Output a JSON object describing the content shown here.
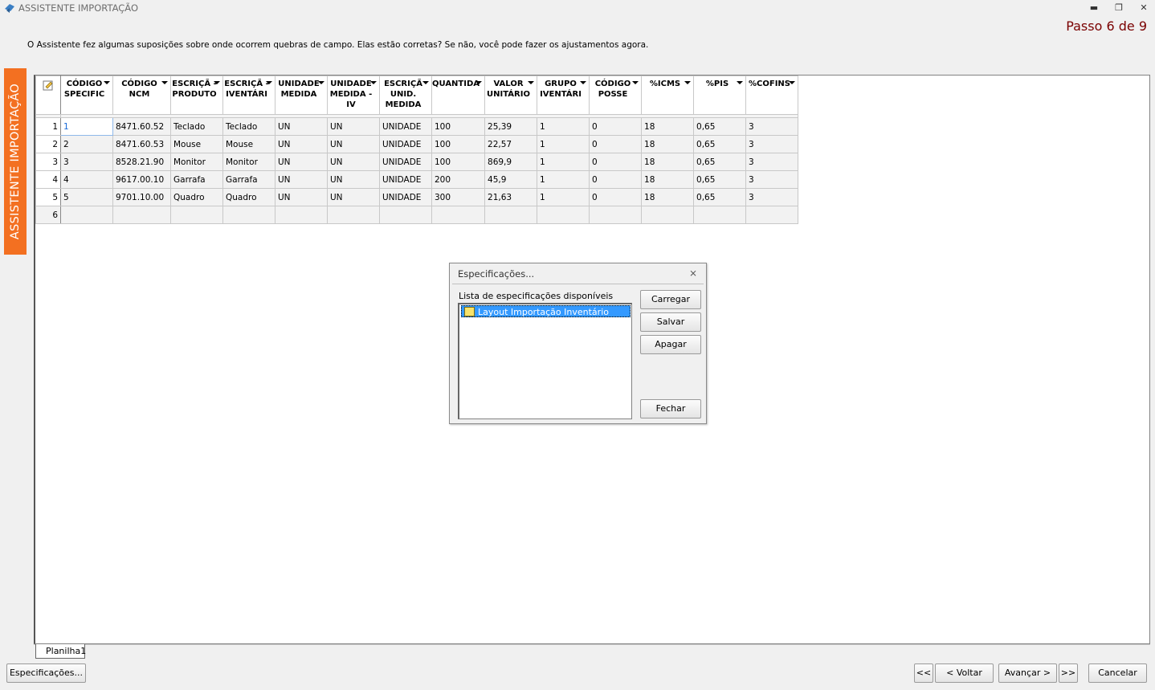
{
  "window": {
    "title": "ASSISTENTE IMPORTAÇÃO",
    "step": "Passo 6 de 9"
  },
  "instruction": "O Assistente fez algumas suposições sobre onde ocorrem quebras de campo. Elas estão corretas? Se não, você pode fazer os ajustamentos agora.",
  "sidetab": "ASSISTENTE IMPORTAÇÃO",
  "grid": {
    "columns": [
      "CÓDIGO SPECIFIC",
      "CÓDIGO NCM",
      "ESCRIÇÃ - PRODUTO",
      "ESCRIÇÃ - IVENTÁRI",
      "UNIDADE MEDIDA",
      "UNIDADE MEDIDA - IV",
      "ESCRIÇÃ UNID. MEDIDA",
      "QUANTIDA",
      "VALOR UNITÁRIO",
      "GRUPO IVENTÁRI",
      "CÓDIGO POSSE",
      "%ICMS",
      "%PIS",
      "%COFINS"
    ],
    "rows": [
      {
        "num": "1",
        "cells": [
          "1",
          "8471.60.52",
          "Teclado",
          "Teclado",
          "UN",
          "UN",
          "UNIDADE",
          "100",
          "25,39",
          "1",
          "0",
          "18",
          "0,65",
          "3"
        ]
      },
      {
        "num": "2",
        "cells": [
          "2",
          "8471.60.53",
          "Mouse",
          "Mouse",
          "UN",
          "UN",
          "UNIDADE",
          "100",
          "22,57",
          "1",
          "0",
          "18",
          "0,65",
          "3"
        ]
      },
      {
        "num": "3",
        "cells": [
          "3",
          "8528.21.90",
          "Monitor",
          "Monitor",
          "UN",
          "UN",
          "UNIDADE",
          "100",
          "869,9",
          "1",
          "0",
          "18",
          "0,65",
          "3"
        ]
      },
      {
        "num": "4",
        "cells": [
          "4",
          "9617.00.10",
          "Garrafa",
          "Garrafa",
          "UN",
          "UN",
          "UNIDADE",
          "200",
          "45,9",
          "1",
          "0",
          "18",
          "0,65",
          "3"
        ]
      },
      {
        "num": "5",
        "cells": [
          "5",
          "9701.10.00",
          "Quadro",
          "Quadro",
          "UN",
          "UN",
          "UNIDADE",
          "300",
          "21,63",
          "1",
          "0",
          "18",
          "0,65",
          "3"
        ]
      },
      {
        "num": "6",
        "cells": [
          "",
          "",
          "",
          "",
          "",
          "",
          "",
          "",
          "",
          "",
          "",
          "",
          "",
          ""
        ]
      }
    ]
  },
  "sheet_tab": "Planilha1",
  "dialog": {
    "title": "Especificações...",
    "label": "Lista de especificações disponíveis",
    "items": [
      "Layout Importação Inventário"
    ],
    "buttons": {
      "load": "Carregar",
      "save": "Salvar",
      "delete": "Apagar",
      "close": "Fechar"
    }
  },
  "footer": {
    "specs": "Especificações...",
    "first": "<<",
    "back": "< Voltar",
    "next": "Avançar >",
    "last": ">>",
    "cancel": "Cancelar"
  },
  "colors": {
    "accent": "#f37021",
    "step_text": "#7a0000",
    "selection": "#3399ff"
  }
}
